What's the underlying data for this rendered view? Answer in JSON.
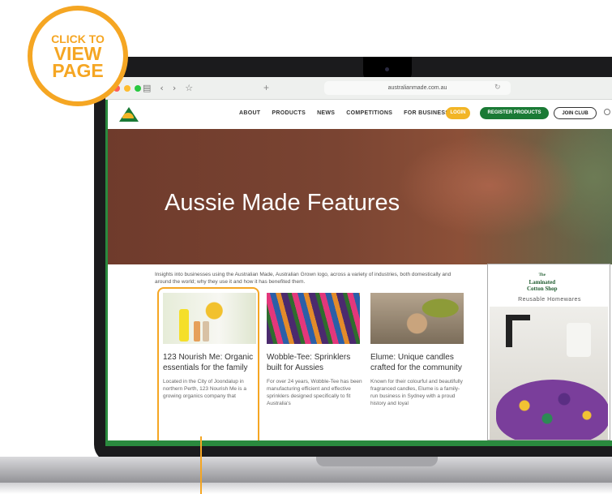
{
  "badge": {
    "line1": "CLICK TO",
    "line2": "VIEW",
    "line3": "PAGE"
  },
  "browser": {
    "url": "australianmade.com.au",
    "nav_icons": [
      "sidebar-icon",
      "back-icon",
      "forward-icon",
      "star-icon"
    ]
  },
  "site": {
    "nav": {
      "links": [
        "ABOUT",
        "PRODUCTS",
        "NEWS",
        "COMPETITIONS",
        "FOR BUSINESS"
      ],
      "login": "LOGIN",
      "register": "REGISTER PRODUCTS",
      "join": "JOIN CLUB"
    },
    "hero_title": "Aussie Made Features",
    "intro": "Insights into businesses using the Australian Made, Australian Grown logo, across a variety of industries, both domestically and around the world; why they use it and how it has benefited them.",
    "cards": [
      {
        "title": "123 Nourish Me: Organic essentials for the family",
        "desc": "Located in the City of Joondalup in northern Perth, 123 Nourish Me is a growing organics company that"
      },
      {
        "title": "Wobble-Tee: Sprinklers built for Aussies",
        "desc": "For over 24 years, Wobble-Tee has been manufacturing efficient and effective sprinklers designed specifically to fit Australia's"
      },
      {
        "title": "Elume: Unique candles crafted for the community",
        "desc": "Known for their colourful and beautifully fragranced candles, Elume is a family-run business in Sydney with a proud history and loyal"
      }
    ],
    "ad": {
      "brand_small": "The",
      "brand_line1": "Laminated",
      "brand_line2": "Cotton Shop",
      "subtitle": "Reusable Homewares"
    }
  },
  "colors": {
    "accent": "#f5a623",
    "brand_green": "#1a7a35",
    "gold": "#f2b526"
  }
}
